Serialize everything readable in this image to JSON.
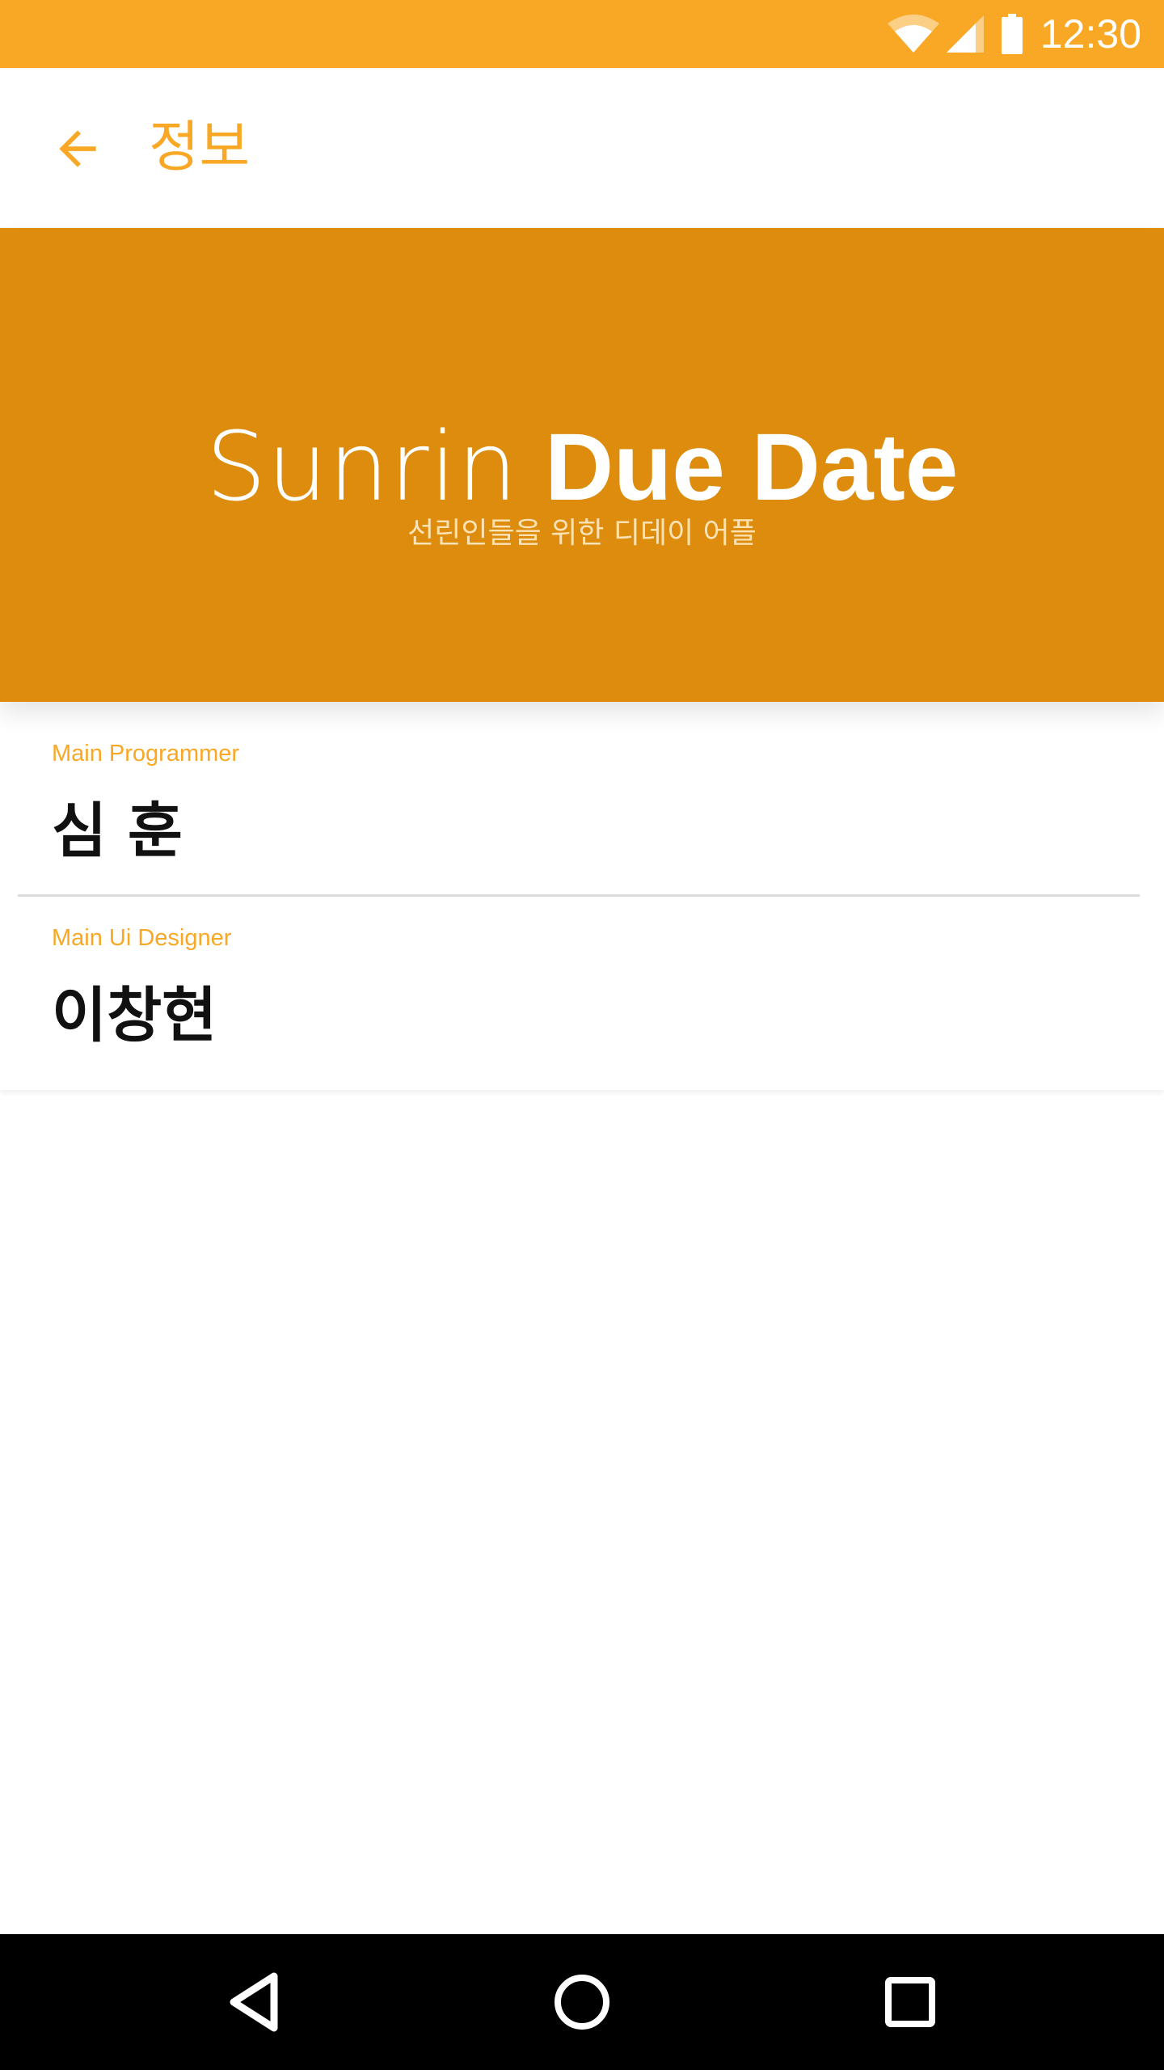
{
  "status_bar": {
    "time": "12:30",
    "background_color": "#F9A825",
    "icons": [
      "wifi-icon",
      "cellular-signal-icon",
      "battery-icon"
    ]
  },
  "app_bar": {
    "title": "정보",
    "back_icon": "arrow-back-icon",
    "accent_color": "#F9A825"
  },
  "hero": {
    "title_light": "Sunrin",
    "title_bold": "Due Date",
    "subtitle": "선린인들을 위한 디데이 어플",
    "background_color": "#DD8C0E"
  },
  "credits": [
    {
      "role": "Main Programmer",
      "name": "심 훈"
    },
    {
      "role": "Main Ui Designer",
      "name": "이창현"
    }
  ],
  "nav_bar": {
    "buttons": [
      "back-triangle-icon",
      "home-circle-icon",
      "recents-square-icon"
    ]
  }
}
